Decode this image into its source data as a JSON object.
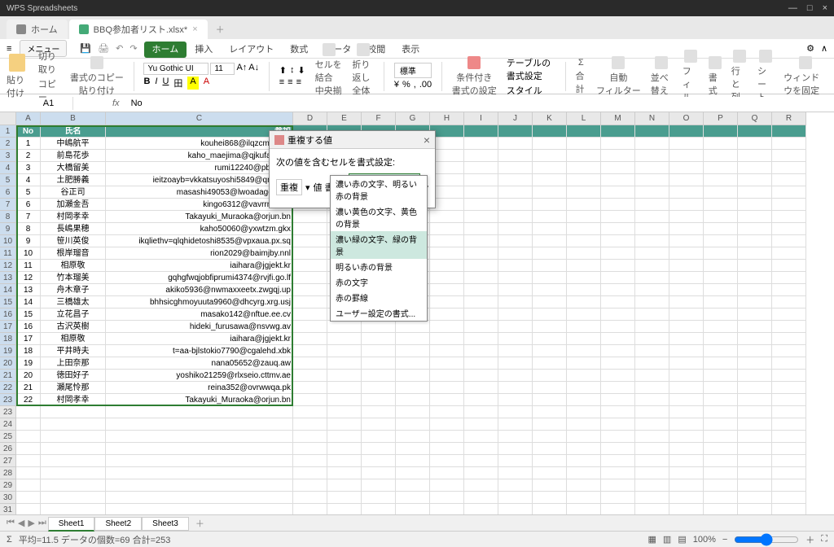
{
  "app": {
    "name": "WPS Spreadsheets"
  },
  "tabs": {
    "home": "ホーム",
    "file": {
      "name": "BBQ参加者リスト.xlsx*",
      "close": "×"
    },
    "add": "＋"
  },
  "ribbon": {
    "menu": "メニュー",
    "tabs": [
      "ホーム",
      "挿入",
      "レイアウト",
      "数式",
      "データ",
      "校閲",
      "表示"
    ],
    "active": 0,
    "font": {
      "name": "Yu Gothic UI",
      "size": "11"
    },
    "groups": {
      "paste": "貼り付け",
      "cut": "切り取り",
      "copy": "コピー",
      "format_copy": "書式のコピー\n貼り付け",
      "merge": "セルを結合",
      "center": "中央揃え",
      "wrap": "折り返し",
      "fullview": "全体表示",
      "standard": "標準",
      "cond_format": "条件付き\n書式の設定",
      "table_format": "テーブルの書式設定",
      "style": "スタイル",
      "sum": "合計",
      "autofilter": "自動\nフィルター",
      "sort": "並べ替え",
      "fill": "フィル",
      "format": "書式",
      "rowcol": "行と列",
      "sheet": "シート",
      "freeze": "ウィンドウを固定"
    }
  },
  "formula_bar": {
    "cell": "A1",
    "fx": "fx",
    "value": "No"
  },
  "columns": [
    "A",
    "B",
    "C",
    "D",
    "E",
    "F",
    "G",
    "H",
    "I",
    "J",
    "K",
    "L",
    "M",
    "N",
    "O",
    "P",
    "Q",
    "R"
  ],
  "headers": {
    "no": "No",
    "name": "氏名",
    "email": "参加"
  },
  "rows": [
    {
      "no": "1",
      "name": "中嶋航平",
      "email": "kouhei868@ilqzcmzfc.yft"
    },
    {
      "no": "2",
      "name": "前島花歩",
      "email": "kaho_maejima@qjkufab.mvt"
    },
    {
      "no": "3",
      "name": "大橋留美",
      "email": "rumi12240@pbhg.eq"
    },
    {
      "no": "4",
      "name": "土肥勝義",
      "email": "ieitzoayb=vkkatsuyoshi5849@qntocvv"
    },
    {
      "no": "5",
      "name": "谷正司",
      "email": "masashi49053@lwoadago.pmb"
    },
    {
      "no": "6",
      "name": "加瀬金吾",
      "email": "kingo6312@vavrrnav.mf"
    },
    {
      "no": "7",
      "name": "村岡孝幸",
      "email": "Takayuki_Muraoka@orjun.bn"
    },
    {
      "no": "8",
      "name": "長嶋果穂",
      "email": "kaho50060@yxwtzm.gkx"
    },
    {
      "no": "9",
      "name": "笹川英俊",
      "email": "ikqliethv=qlqhidetoshi8535@vpxaua.px.sq"
    },
    {
      "no": "10",
      "name": "根岸瑠音",
      "email": "rion2029@baimjby.nnl"
    },
    {
      "no": "11",
      "name": "相原敬",
      "email": "iaihara@jgjekt.kr"
    },
    {
      "no": "12",
      "name": "竹本瑠美",
      "email": "gqhgfwqjobfiprumi4374@rvjfi.go.lf"
    },
    {
      "no": "13",
      "name": "舟木章子",
      "email": "akiko5936@nwmaxxeetx.zwgqj.up"
    },
    {
      "no": "14",
      "name": "三橋雄太",
      "email": "bhhsicghmoyuuta9960@dhcyrg.xrg.usj"
    },
    {
      "no": "15",
      "name": "立花昌子",
      "email": "masako142@nftue.ee.cv"
    },
    {
      "no": "16",
      "name": "古沢英樹",
      "email": "hideki_furusawa@nsvwg.av"
    },
    {
      "no": "17",
      "name": "相原敬",
      "email": "iaihara@jgjekt.kr"
    },
    {
      "no": "18",
      "name": "平井時夫",
      "email": "t=aa-bjlstokio7790@cgalehd.xbk"
    },
    {
      "no": "19",
      "name": "上田奈那",
      "email": "nana05652@zauq.aw"
    },
    {
      "no": "20",
      "name": "徳田好子",
      "email": "yoshiko21259@rlxseio.cttmv.ae"
    },
    {
      "no": "21",
      "name": "瀬尾怜那",
      "email": "reina352@ovrwwqa.pk"
    },
    {
      "no": "22",
      "name": "村岡孝幸",
      "email": "Takayuki_Muraoka@orjun.bn"
    }
  ],
  "empty_rows": [
    "23",
    "24",
    "25",
    "26",
    "27",
    "28",
    "29",
    "30",
    "31"
  ],
  "dialog": {
    "title": "重複する値",
    "label": "次の値を含むセルを書式設定:",
    "dup": "重複",
    "val": "値 書式:",
    "selected": "濃い赤の文字、明るい赤の背景",
    "options": [
      "濃い赤の文字、明るい赤の背景",
      "濃い黄色の文字、黄色の背景",
      "濃い緑の文字、緑の背景",
      "明るい赤の背景",
      "赤の文字",
      "赤の罫線",
      "ユーザー設定の書式..."
    ],
    "close": "×"
  },
  "sheets": {
    "list": [
      "Sheet1",
      "Sheet2",
      "Sheet3"
    ],
    "active": 0,
    "add": "＋"
  },
  "status": {
    "text": "平均=11.5  データの個数=69  合計=253",
    "zoom": "100%"
  }
}
